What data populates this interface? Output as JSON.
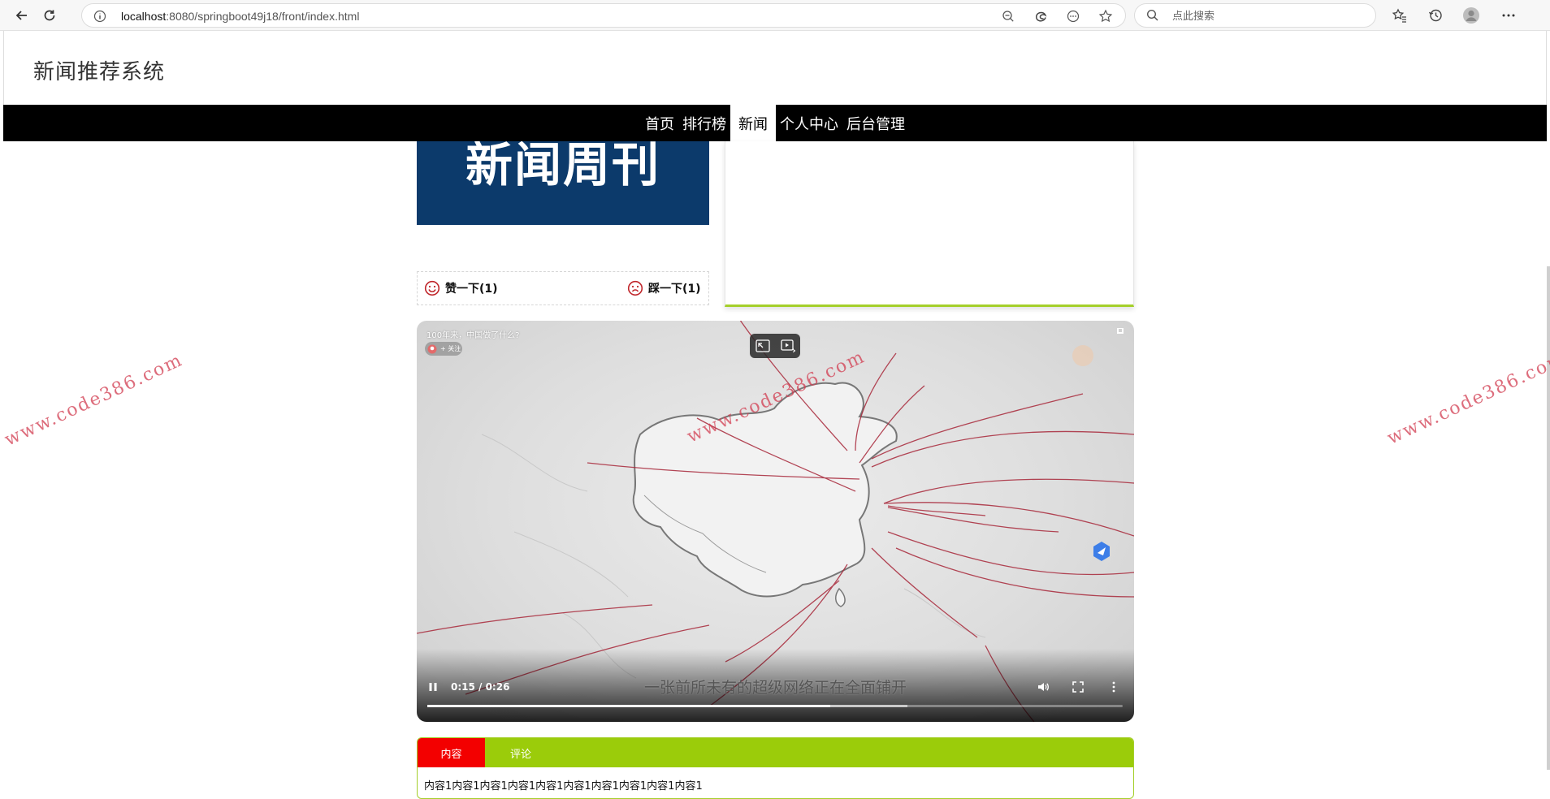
{
  "browser": {
    "url_host": "localhost",
    "url_rest": ":8080/springboot49j18/front/index.html",
    "search_placeholder": "点此搜索"
  },
  "site": {
    "title": "新闻推荐系统"
  },
  "nav": {
    "items": [
      {
        "label": "首页",
        "active": false
      },
      {
        "label": "排行榜",
        "active": false
      },
      {
        "label": "新闻",
        "active": true
      },
      {
        "label": "个人中心",
        "active": false
      },
      {
        "label": "后台管理",
        "active": false
      }
    ]
  },
  "poster": {
    "text": "新闻周刊"
  },
  "votes": {
    "like_label": "赞一下(1)",
    "dislike_label": "踩一下(1)"
  },
  "video": {
    "title": "100年来，中国做了什么?",
    "follow_label": "+ 关注",
    "subtitle": "一张前所未有的超级网络正在全面铺开",
    "time": "0:15 / 0:26",
    "progress_played": 0.58,
    "progress_buffered": 0.69
  },
  "tabs": {
    "items": [
      {
        "label": "内容",
        "active": true
      },
      {
        "label": "评论",
        "active": false
      }
    ],
    "content": "内容1内容1内容1内容1内容1内容1内容1内容1内容1内容1"
  },
  "watermark": {
    "text": "www.code386.com"
  },
  "colors": {
    "nav_bg": "#000000",
    "accent_green": "#9bcc0a",
    "active_tab_red": "#f30000",
    "poster_blue": "#0c3a6b",
    "vote_icon_red": "#c0262b"
  }
}
